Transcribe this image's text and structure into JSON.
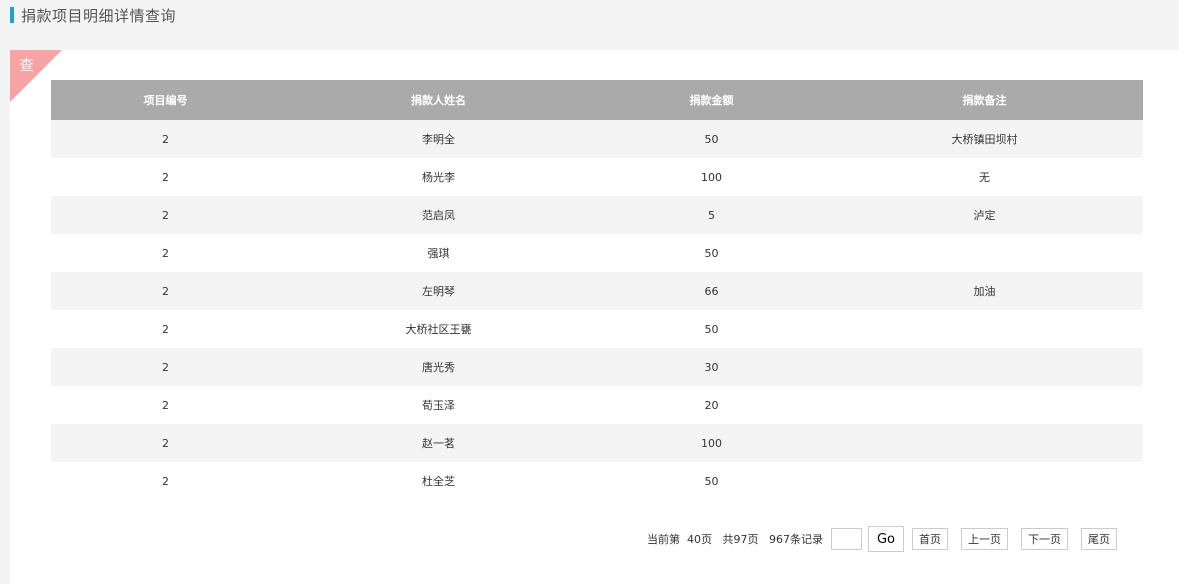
{
  "header": {
    "title": "捐款项目明细详情查询"
  },
  "badge": {
    "label": "查"
  },
  "table": {
    "columns": [
      "项目编号",
      "捐款人姓名",
      "捐款金额",
      "捐款备注"
    ],
    "rows": [
      [
        "2",
        "李明全",
        "50",
        "大桥镇田坝村"
      ],
      [
        "2",
        "杨光李",
        "100",
        "无"
      ],
      [
        "2",
        "范启凤",
        "5",
        "泸定"
      ],
      [
        "2",
        "强琪",
        "50",
        ""
      ],
      [
        "2",
        "左明琴",
        "66",
        "加油"
      ],
      [
        "2",
        "大桥社区王甕",
        "50",
        ""
      ],
      [
        "2",
        "唐光秀",
        "30",
        ""
      ],
      [
        "2",
        "荀玉泽",
        "20",
        ""
      ],
      [
        "2",
        "赵一茗",
        "100",
        ""
      ],
      [
        "2",
        "杜全芝",
        "50",
        ""
      ]
    ]
  },
  "pager": {
    "info": "当前第  40页   共97页   967条记录",
    "jump_value": "",
    "go_label": "Go",
    "first_label": "首页",
    "prev_label": "上一页",
    "next_label": "下一页",
    "last_label": "尾页"
  }
}
